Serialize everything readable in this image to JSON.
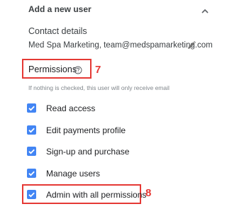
{
  "header": {
    "title": "Add a new user",
    "toggle_icon": "chevron-up-icon"
  },
  "contact": {
    "label": "Contact details",
    "value": "Med Spa Marketing, team@medspamarketing.com",
    "edit_icon": "pencil-icon"
  },
  "permissions": {
    "label": "Permissions",
    "help_icon": "help-circle-icon",
    "hint": "If nothing is checked, this user will only receive email",
    "items": [
      {
        "label": "Read access",
        "checked": true
      },
      {
        "label": "Edit payments profile",
        "checked": true
      },
      {
        "label": "Sign-up and purchase",
        "checked": true
      },
      {
        "label": "Manage users",
        "checked": true
      },
      {
        "label": "Admin with all permissions",
        "checked": true
      }
    ]
  },
  "annotations": {
    "permissions_marker": "7",
    "admin_marker": "8",
    "color": "#e53935"
  },
  "colors": {
    "checkbox": "#4285f4",
    "text": "#202124",
    "muted": "#80868b"
  }
}
